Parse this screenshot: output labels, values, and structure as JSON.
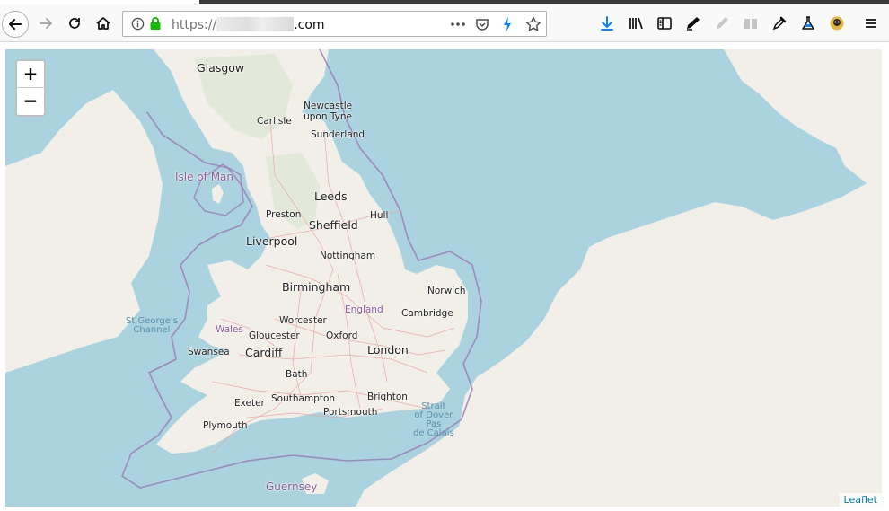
{
  "browser": {
    "url_prefix": "https://",
    "url_suffix": ".com",
    "toolbar_icons": [
      "back-icon",
      "forward-icon",
      "reload-icon",
      "home-icon",
      "info-icon",
      "lock-icon",
      "more-icon",
      "pocket-icon",
      "lightning-icon",
      "bookmark-star-icon",
      "download-icon",
      "library-icon",
      "sidebar-icon",
      "ink-icon",
      "pen-icon",
      "reader-icon",
      "dropper-icon",
      "flask-icon",
      "avatar-icon",
      "menu-icon"
    ]
  },
  "map": {
    "zoom_in_label": "+",
    "zoom_out_label": "−",
    "attribution": "Leaflet",
    "colors": {
      "sea": "#aad3df",
      "land": "#f2efe9",
      "border": "#9b7cb5"
    },
    "labels": {
      "glasgow": "Glasgow",
      "newcastle": "Newcastle\nupon Tyne",
      "carlisle": "Carlisle",
      "sunderland": "Sunderland",
      "isle_of_man": "Isle of Man",
      "leeds": "Leeds",
      "preston": "Preston",
      "hull": "Hull",
      "sheffield": "Sheffield",
      "liverpool": "Liverpool",
      "nottingham": "Nottingham",
      "birmingham": "Birmingham",
      "norwich": "Norwich",
      "england": "England",
      "cambridge": "Cambridge",
      "st_georges": "St George's\nChannel",
      "worcester": "Worcester",
      "wales": "Wales",
      "gloucester": "Gloucester",
      "oxford": "Oxford",
      "swansea": "Swansea",
      "cardiff": "Cardiff",
      "london": "London",
      "bath": "Bath",
      "exeter": "Exeter",
      "southampton": "Southampton",
      "brighton": "Brighton",
      "strait": "Strait\nof Dover\nPas\nde Calais",
      "portsmouth": "Portsmouth",
      "plymouth": "Plymouth",
      "guernsey": "Guernsey"
    }
  }
}
